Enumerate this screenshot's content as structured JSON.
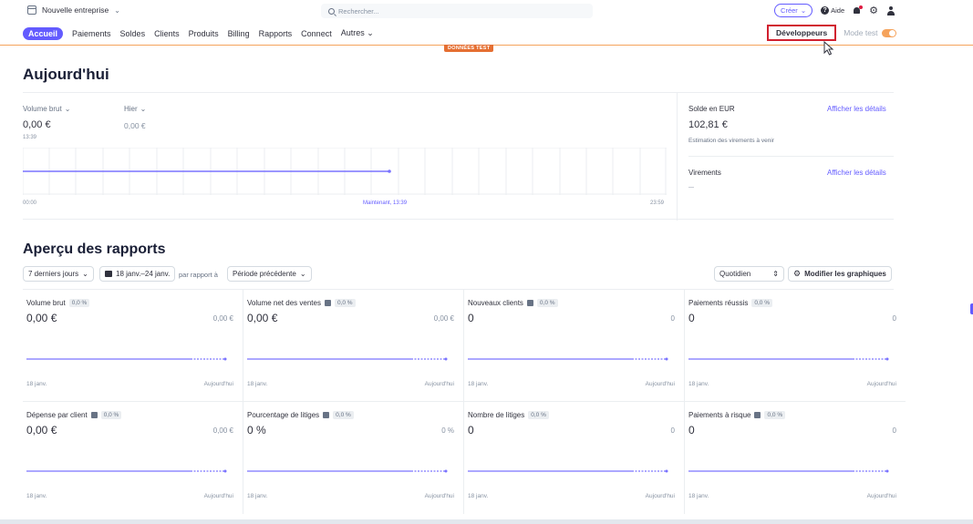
{
  "topbar": {
    "business_name": "Nouvelle entreprise",
    "search_placeholder": "Rechercher...",
    "create_label": "Créer",
    "help_label": "Aide"
  },
  "nav": {
    "items": [
      "Accueil",
      "Paiements",
      "Soldes",
      "Clients",
      "Produits",
      "Billing",
      "Rapports",
      "Connect",
      "Autres"
    ],
    "developers_label": "Développeurs",
    "mode_label": "Mode test",
    "test_badge": "DONNÉES TEST"
  },
  "today": {
    "title": "Aujourd'hui",
    "gross_volume_label": "Volume brut",
    "gross_volume_value": "0,00 €",
    "gross_volume_time": "13:39",
    "yesterday_label": "Hier",
    "yesterday_value": "0,00 €",
    "axis_start": "00:00",
    "axis_now": "Maintenant, 13:39",
    "axis_end": "23:59",
    "balance_label": "Solde en EUR",
    "balance_value": "102,81 €",
    "balance_desc": "Estimation des virements à venir",
    "details_link": "Afficher les détails",
    "transfers_label": "Virements",
    "transfers_value": "—",
    "transfers_link": "Afficher les détails"
  },
  "reports": {
    "title": "Aperçu des rapports",
    "range_label": "7 derniers jours",
    "date_range": "18 janv.–24 janv.",
    "compare_label": "par rapport à",
    "compare_value": "Période précédente",
    "interval_label": "Quotidien",
    "modify_label": "Modifier les graphiques",
    "cards": [
      {
        "title": "Volume brut",
        "pct": "0,0 %",
        "value": "0,00 €",
        "prev": "0,00 €",
        "start": "18 janv.",
        "end": "Aujourd'hui",
        "info": false
      },
      {
        "title": "Volume net des ventes",
        "pct": "0,0 %",
        "value": "0,00 €",
        "prev": "0,00 €",
        "start": "18 janv.",
        "end": "Aujourd'hui",
        "info": true
      },
      {
        "title": "Nouveaux clients",
        "pct": "0,0 %",
        "value": "0",
        "prev": "0",
        "start": "18 janv.",
        "end": "Aujourd'hui",
        "info": true
      },
      {
        "title": "Paiements réussis",
        "pct": "0,0 %",
        "value": "0",
        "prev": "0",
        "start": "18 janv.",
        "end": "Aujourd'hui",
        "info": false
      },
      {
        "title": "Dépense par client",
        "pct": "0,0 %",
        "value": "0,00 €",
        "prev": "0,00 €",
        "start": "18 janv.",
        "end": "Aujourd'hui",
        "info": true
      },
      {
        "title": "Pourcentage de litiges",
        "pct": "0,0 %",
        "value": "0 %",
        "prev": "0 %",
        "start": "18 janv.",
        "end": "Aujourd'hui",
        "info": true
      },
      {
        "title": "Nombre de litiges",
        "pct": "0,0 %",
        "value": "0",
        "prev": "0",
        "start": "18 janv.",
        "end": "Aujourd'hui",
        "info": false
      },
      {
        "title": "Paiements à risque",
        "pct": "0,0 %",
        "value": "0",
        "prev": "0",
        "start": "18 janv.",
        "end": "Aujourd'hui",
        "info": true
      }
    ]
  },
  "colors": {
    "accent": "#635bff",
    "test_mode": "#f5a35c",
    "highlight": "#d1202f"
  }
}
